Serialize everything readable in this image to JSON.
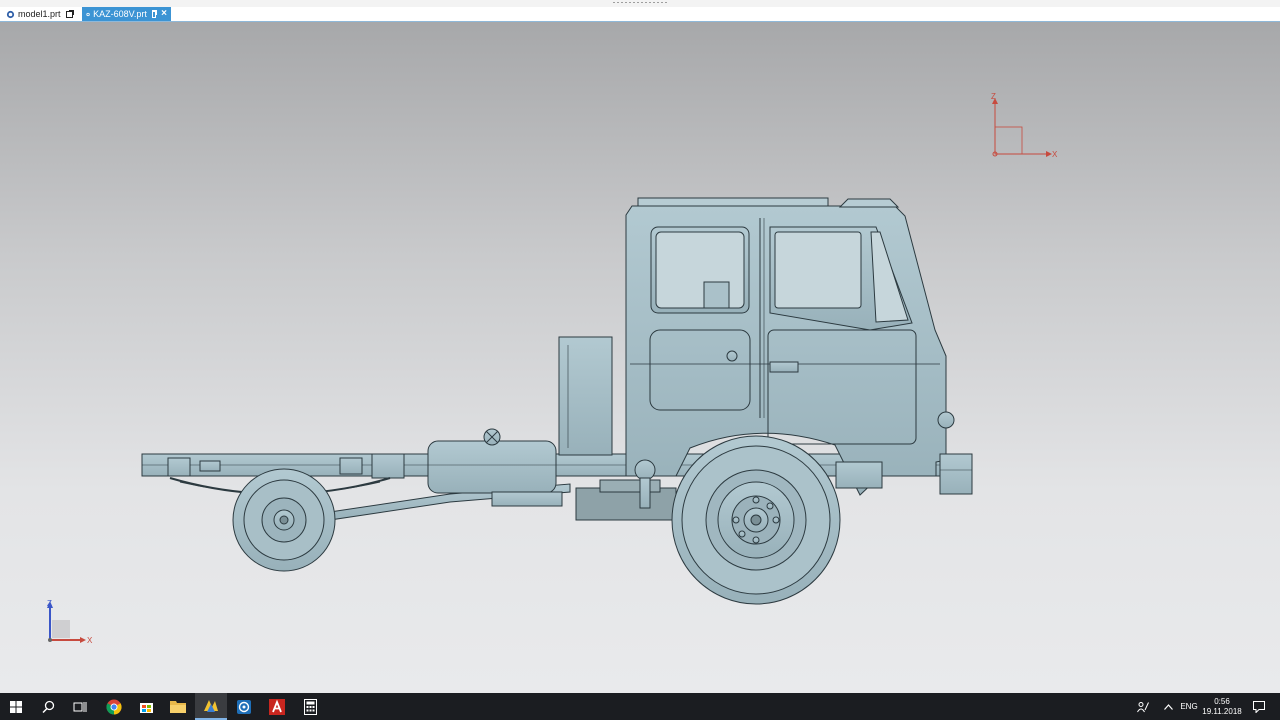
{
  "tabs": [
    {
      "label": "model1.prt",
      "active": false
    },
    {
      "label": "KAZ-608V.prt",
      "active": true
    }
  ],
  "viewport": {
    "triad_main": {
      "z": "Z",
      "x": "X"
    },
    "triad_corner": {
      "z": "Z",
      "x": "X"
    }
  },
  "taskbar": {
    "apps": [
      "start",
      "search",
      "task-view",
      "chrome",
      "store",
      "file-explorer",
      "nx",
      "app-blue",
      "autocad",
      "calculator"
    ],
    "tray": {
      "language": "ENG",
      "time": "0:56",
      "date": "19.11.2018"
    }
  },
  "colors": {
    "active_tab": "#3c94d4",
    "taskbar": "#1b1d21",
    "model": "#a4bcc4",
    "triad_x": "#c74a3e",
    "triad_z": "#3a56c8"
  }
}
